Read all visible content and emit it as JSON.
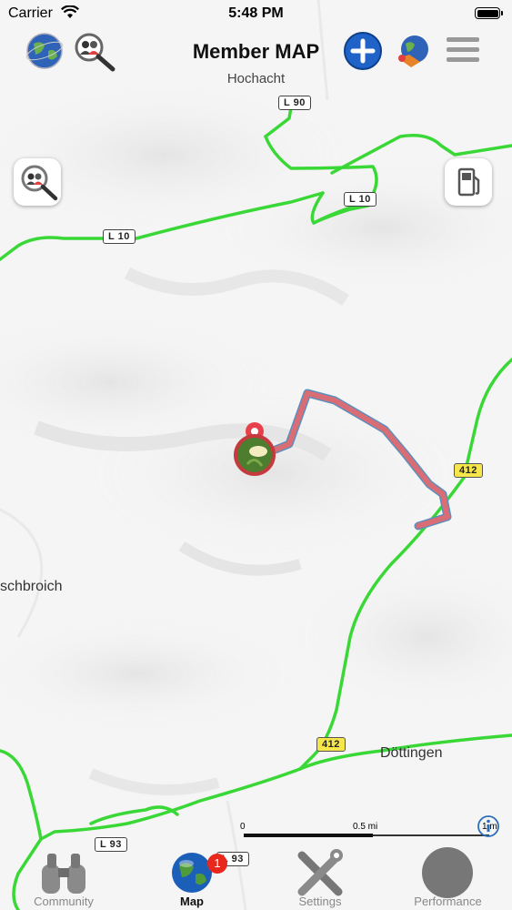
{
  "status_bar": {
    "carrier": "Carrier",
    "time": "5:48 PM"
  },
  "header": {
    "title": "Member MAP",
    "subtitle": "Hochacht",
    "left_icons": [
      "globe-icon",
      "member-search-icon"
    ],
    "right_icons": [
      "add-icon",
      "globe-pin-icon",
      "menu-icon"
    ]
  },
  "map": {
    "road_labels": [
      "L 90",
      "L 10",
      "L 10",
      "412",
      "412",
      "L 93",
      "L 93"
    ],
    "places": [
      "schbroich",
      "Döttingen"
    ],
    "scale": {
      "start": "0",
      "middle": "0.5 mi",
      "end": "1 mi"
    },
    "colors": {
      "road": "#39d836",
      "route": "#d86d75",
      "route_outline": "#5d8fbc",
      "pin": "#e8404a"
    }
  },
  "buttons": {
    "member_search": "member-search-icon",
    "fuel": "fuel-pump-icon"
  },
  "tabs": [
    {
      "label": "Community",
      "icon": "binoculars-icon"
    },
    {
      "label": "Map",
      "icon": "globe-icon",
      "badge": "1"
    },
    {
      "label": "Settings",
      "icon": "tools-icon"
    },
    {
      "label": "Performance",
      "icon": "gauge-icon"
    }
  ]
}
